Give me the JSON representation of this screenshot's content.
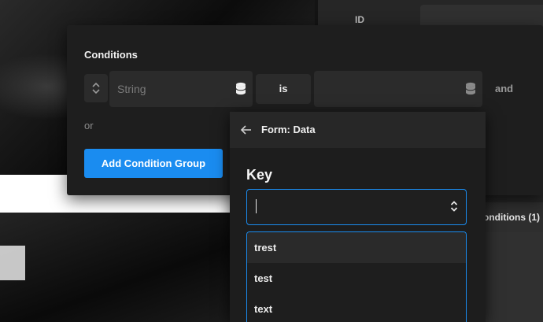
{
  "background": {
    "right_panel": {
      "id_label": "ID",
      "conditions_tab": "onditions (1)"
    }
  },
  "conditions_modal": {
    "title": "Conditions",
    "row": {
      "type_value": "String",
      "operator": "is",
      "value": "",
      "joiner": "and"
    },
    "or_label": "or",
    "add_group_button": "Add Condition Group"
  },
  "data_popover": {
    "title": "Form: Data",
    "key_label": "Key",
    "key_value": "",
    "options": [
      "trest",
      "test",
      "text"
    ],
    "highlighted_index": 0
  },
  "colors": {
    "accent": "#1a8cf0",
    "modal_bg": "#1e1e1e",
    "field_bg": "#2b2b2b"
  },
  "icons": [
    "sort-icon",
    "database-icon",
    "arrow-left-icon",
    "chevron-updown-icon"
  ]
}
